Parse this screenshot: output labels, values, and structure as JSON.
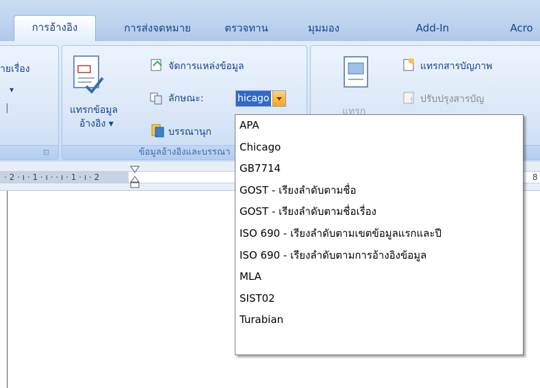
{
  "tabs": [
    {
      "label": "การอ้างอิง",
      "active": true
    },
    {
      "label": "การส่งจดหมาย",
      "active": false
    },
    {
      "label": "ตรวจทาน",
      "active": false
    },
    {
      "label": "มุมมอง",
      "active": false
    },
    {
      "label": "Add-In",
      "active": false
    },
    {
      "label": "Acro",
      "active": false
    }
  ],
  "ribbon": {
    "left_partial_label": "ายเรื่อง",
    "insert_citation": {
      "line1": "แทรกข้อมูล",
      "line2": "อ้างอิง ▾"
    },
    "manage_sources": "จัดการแหล่งข้อมูล",
    "style_label": "ลักษณะ:",
    "style_value": "hicago",
    "bibliography": "บรรณานุก",
    "group_caption": "ข้อมูลอ้างอิงและบรรณา",
    "insert_caption": "แทรกสารบัญภาพ",
    "update_table": "ปรับปรุงสารบัญ",
    "caption_partial": "แทรก"
  },
  "ruler": {
    "text": "· 2 · ı · 1 · ı ·  · ı · 1 · ı · 2",
    "right_number": "8"
  },
  "style_dropdown": {
    "options": [
      "APA",
      "Chicago",
      "GB7714",
      "GOST - เรียงลำดับตามชื่อ",
      "GOST - เรียงลำดับตามชื่อเรื่อง",
      "ISO 690 - เรียงลำดับตามเขตข้อมูลแรกและปี",
      "ISO 690 - เรียงลำดับตามการอ้างอิงข้อมูล",
      "MLA",
      "SIST02",
      "Turabian"
    ]
  },
  "colors": {
    "accent": "#15428b",
    "highlight": "#3169c6",
    "dropdown_arrow": "#f5a623"
  }
}
